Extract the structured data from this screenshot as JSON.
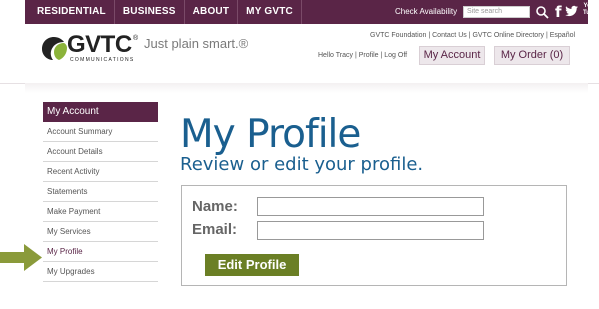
{
  "topnav": {
    "items": [
      "RESIDENTIAL",
      "BUSINESS",
      "ABOUT",
      "MY GVTC"
    ],
    "check_availability": "Check Availability",
    "search_placeholder": "Site search",
    "youtube_label_1": "You",
    "youtube_label_2": "Tube"
  },
  "header": {
    "logo_text": "GVTC",
    "logo_registered": "®",
    "logo_sub": "COMMUNICATIONS",
    "tagline": "Just plain smart.®",
    "util_links": "GVTC Foundation  |  Contact Us  |  GVTC Online Directory  |  Español",
    "user_links": "Hello Tracy  |  Profile  |  Log Off",
    "my_account_button": "My Account",
    "my_order_button": "My Order (0)"
  },
  "sidebar": {
    "title": "My Account",
    "items": [
      {
        "label": "Account Summary"
      },
      {
        "label": "Account Details"
      },
      {
        "label": "Recent Activity"
      },
      {
        "label": "Statements"
      },
      {
        "label": "Make Payment"
      },
      {
        "label": "My Services"
      },
      {
        "label": "My Profile"
      },
      {
        "label": "My Upgrades"
      }
    ],
    "active_index": 6
  },
  "main": {
    "title": "My Profile",
    "subtitle": "Review or edit your profile.",
    "name_label": "Name:",
    "name_value": "",
    "email_label": "Email:",
    "email_value": "",
    "edit_button": "Edit Profile"
  },
  "colors": {
    "brand_purple": "#5a2547",
    "title_blue": "#1a5f8f",
    "button_green": "#6b7f25",
    "arrow_green": "#8a9a3a"
  }
}
